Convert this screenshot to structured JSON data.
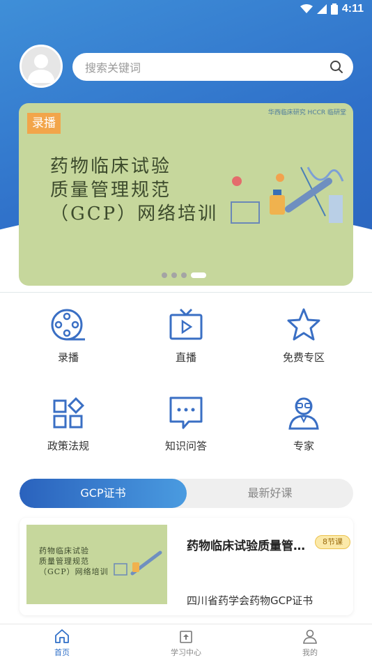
{
  "status_bar": {
    "time": "4:11"
  },
  "search": {
    "placeholder": "搜索关键词",
    "icon": "search-icon"
  },
  "banner": {
    "tag": "录播",
    "title_lines": [
      "药物临床试验",
      "质量管理规范",
      "（GCP）网络培训"
    ],
    "logos": "华西临床研究 HCCR 临研堂",
    "slides": 4,
    "active_slide": 4
  },
  "menu": [
    {
      "label": "录播",
      "icon": "film-reel-icon"
    },
    {
      "label": "直播",
      "icon": "live-tv-icon"
    },
    {
      "label": "免费专区",
      "icon": "star-icon"
    },
    {
      "label": "政策法规",
      "icon": "policy-grid-icon"
    },
    {
      "label": "知识问答",
      "icon": "chat-bubble-icon"
    },
    {
      "label": "专家",
      "icon": "expert-icon"
    }
  ],
  "tabs": [
    {
      "label": "GCP证书",
      "active": true
    },
    {
      "label": "最新好课",
      "active": false
    }
  ],
  "course": {
    "title": "药物临床试验质量管理规范（GCP）网络培训",
    "thumb_lines": [
      "药物临床试验",
      "质量管理规范",
      "（GCP）网络培训"
    ],
    "badge": "8节课",
    "subtitle": "四川省药学会药物GCP证书"
  },
  "bottom_nav": [
    {
      "label": "首页",
      "icon": "home-icon",
      "active": true
    },
    {
      "label": "学习中心",
      "icon": "study-center-icon",
      "active": false
    },
    {
      "label": "我的",
      "icon": "profile-icon",
      "active": false
    }
  ],
  "colors": {
    "primary": "#2f6fc8",
    "banner_bg": "#c6d79c",
    "tag": "#f2a54a",
    "badge": "#fbe9a9"
  }
}
